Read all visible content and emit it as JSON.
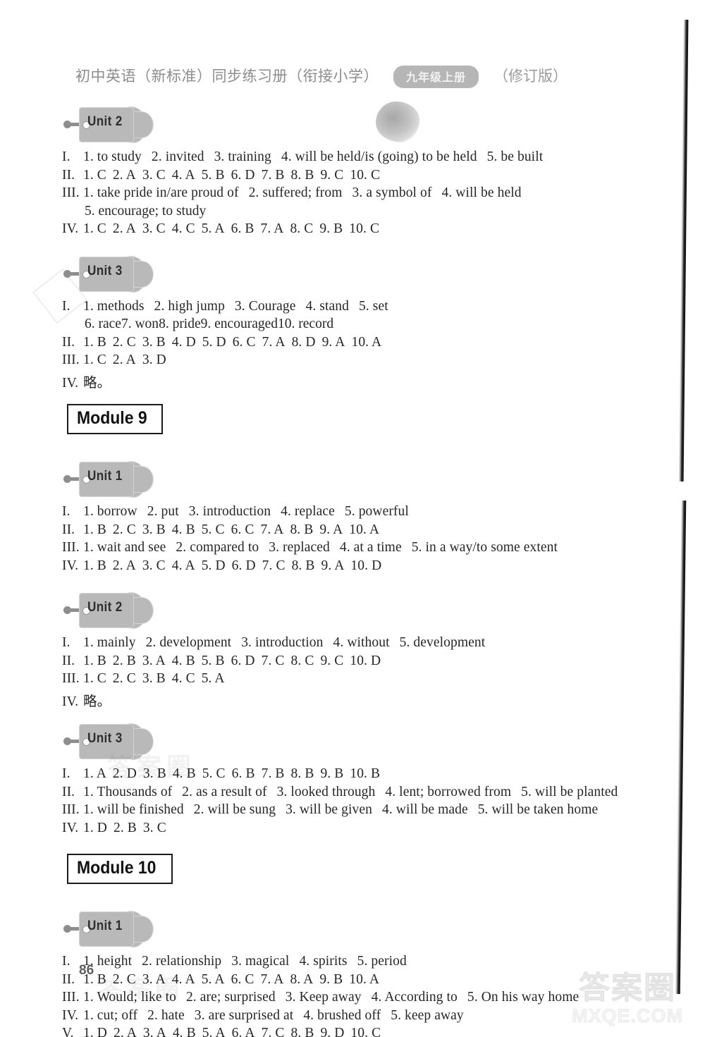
{
  "header": {
    "title": "初中英语（新标准）同步练习册（衔接小学）",
    "grade_badge": "九年级上册",
    "edition": "（修订版）"
  },
  "page_number": "86",
  "watermarks": {
    "brand_cn": "答案圈",
    "brand_en": "MXQE.COM",
    "faint_mid": "答案圈",
    "faint_footer": "答案圈"
  },
  "sections": [
    {
      "kind": "unit",
      "tag": "Unit 2",
      "lines": [
        {
          "rn": "I.",
          "items": [
            "1. to study",
            "2. invited",
            "3. training",
            "4. will be held/is (going) to be held",
            "5. be built"
          ],
          "spacing": "wide"
        },
        {
          "rn": "II.",
          "items": [
            "1. C",
            "2. A",
            "3. C",
            "4. A",
            "5. B",
            "6. D",
            "7. B",
            "8. B",
            "9. C",
            "10. C"
          ],
          "spacing": "tight"
        },
        {
          "rn": "III.",
          "items": [
            "1. take pride in/are proud of",
            "2. suffered; from",
            "3. a symbol of",
            "4. will be held"
          ],
          "spacing": "wide"
        },
        {
          "rn": "",
          "items": [
            "5. encourage; to study"
          ],
          "spacing": "wide",
          "continuation": true
        },
        {
          "rn": "IV.",
          "items": [
            "1. C",
            "2. A",
            "3. C",
            "4. C",
            "5. A",
            "6. B",
            "7. A",
            "8. C",
            "9. B",
            "10. C"
          ],
          "spacing": "tight"
        }
      ]
    },
    {
      "kind": "unit",
      "tag": "Unit 3",
      "lines": [
        {
          "rn": "I.",
          "items": [
            "1. methods",
            "2. high jump",
            "3. Courage",
            "4. stand",
            "5. set"
          ],
          "spacing": "wide"
        },
        {
          "rn": "",
          "items": [
            "6. race",
            "7. won",
            "8. pride",
            "9. encouraged",
            "10. record"
          ],
          "spacing": "wide",
          "continuation": true
        },
        {
          "rn": "II.",
          "items": [
            "1. B",
            "2. C",
            "3. B",
            "4. D",
            "5. D",
            "6. C",
            "7. A",
            "8. D",
            "9. A",
            "10. A"
          ],
          "spacing": "tight"
        },
        {
          "rn": "III.",
          "items": [
            "1. C",
            "2. A",
            "3. D"
          ],
          "spacing": "tight"
        },
        {
          "rn": "IV.",
          "items": [
            "略。"
          ],
          "spacing": "tight"
        }
      ]
    },
    {
      "kind": "module",
      "label": "Module 9"
    },
    {
      "kind": "unit",
      "tag": "Unit 1",
      "lines": [
        {
          "rn": "I.",
          "items": [
            "1. borrow",
            "2. put",
            "3. introduction",
            "4. replace",
            "5. powerful"
          ],
          "spacing": "wide"
        },
        {
          "rn": "II.",
          "items": [
            "1. B",
            "2. C",
            "3. B",
            "4. B",
            "5. C",
            "6. C",
            "7. A",
            "8. B",
            "9. A",
            "10. A"
          ],
          "spacing": "tight"
        },
        {
          "rn": "III.",
          "items": [
            "1. wait and see",
            "2. compared to",
            "3. replaced",
            "4. at a time",
            "5. in a way/to some extent"
          ],
          "spacing": "wide"
        },
        {
          "rn": "IV.",
          "items": [
            "1. B",
            "2. A",
            "3. C",
            "4. A",
            "5. D",
            "6. D",
            "7. C",
            "8. B",
            "9. A",
            "10. D"
          ],
          "spacing": "tight"
        }
      ]
    },
    {
      "kind": "unit",
      "tag": "Unit 2",
      "lines": [
        {
          "rn": "I.",
          "items": [
            "1. mainly",
            "2. development",
            "3. introduction",
            "4. without",
            "5. development"
          ],
          "spacing": "wide"
        },
        {
          "rn": "II.",
          "items": [
            "1. B",
            "2. B",
            "3. A",
            "4. B",
            "5. B",
            "6. D",
            "7. C",
            "8. C",
            "9. C",
            "10. D"
          ],
          "spacing": "tight"
        },
        {
          "rn": "III.",
          "items": [
            "1. C",
            "2. C",
            "3. B",
            "4. C",
            "5. A"
          ],
          "spacing": "tight"
        },
        {
          "rn": "IV.",
          "items": [
            "略。"
          ],
          "spacing": "tight"
        }
      ]
    },
    {
      "kind": "unit",
      "tag": "Unit 3",
      "lines": [
        {
          "rn": "I.",
          "items": [
            "1. A",
            "2. D",
            "3. B",
            "4. B",
            "5. C",
            "6. B",
            "7. B",
            "8. B",
            "9. B",
            "10. B"
          ],
          "spacing": "tight"
        },
        {
          "rn": "II.",
          "items": [
            "1. Thousands of",
            "2. as a result of",
            "3. looked through",
            "4. lent; borrowed from",
            "5. will be planted"
          ],
          "spacing": "wide"
        },
        {
          "rn": "III.",
          "items": [
            "1. will be finished",
            "2. will be sung",
            "3. will be given",
            "4. will be made",
            "5. will be taken home"
          ],
          "spacing": "wide"
        },
        {
          "rn": "IV.",
          "items": [
            "1. D",
            "2. B",
            "3. C"
          ],
          "spacing": "tight"
        }
      ]
    },
    {
      "kind": "module",
      "label": "Module 10"
    },
    {
      "kind": "unit",
      "tag": "Unit 1",
      "lines": [
        {
          "rn": "I.",
          "items": [
            "1. height",
            "2. relationship",
            "3. magical",
            "4. spirits",
            "5. period"
          ],
          "spacing": "wide"
        },
        {
          "rn": "II.",
          "items": [
            "1. B",
            "2. C",
            "3. A",
            "4. A",
            "5. A",
            "6. C",
            "7. A",
            "8. A",
            "9. B",
            "10. A"
          ],
          "spacing": "tight"
        },
        {
          "rn": "III.",
          "items": [
            "1. Would; like to",
            "2. are; surprised",
            "3. Keep away",
            "4. According to",
            "5. On his way home"
          ],
          "spacing": "wide"
        },
        {
          "rn": "IV.",
          "items": [
            "1. cut; off",
            "2. hate",
            "3. are surprised at",
            "4. brushed off",
            "5. keep away"
          ],
          "spacing": "wide"
        },
        {
          "rn": "V.",
          "items": [
            "1. D",
            "2. A",
            "3. A",
            "4. B",
            "5. A",
            "6. A",
            "7. C",
            "8. B",
            "9. D",
            "10. C"
          ],
          "spacing": "tight"
        }
      ]
    }
  ]
}
